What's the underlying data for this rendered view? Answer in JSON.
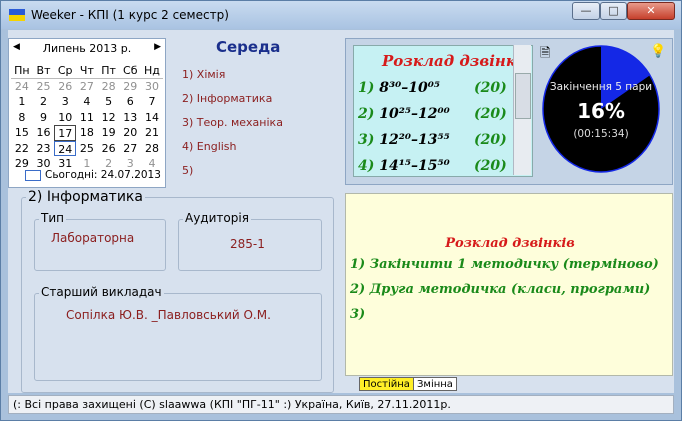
{
  "window": {
    "title": "Weeker - КПІ (1 курс 2 семестр)",
    "controls": {
      "minimize": "—",
      "maximize": "□",
      "close": "✕"
    }
  },
  "calendar": {
    "month_label": "Липень 2013 р.",
    "prev_icon": "◀",
    "next_icon": "▶",
    "weekdays": [
      "Пн",
      "Вт",
      "Ср",
      "Чт",
      "Пт",
      "Сб",
      "Нд"
    ],
    "weeks": [
      [
        "24",
        "25",
        "26",
        "27",
        "28",
        "29",
        "30"
      ],
      [
        "1",
        "2",
        "3",
        "4",
        "5",
        "6",
        "7"
      ],
      [
        "8",
        "9",
        "10",
        "11",
        "12",
        "13",
        "14"
      ],
      [
        "15",
        "16",
        "17",
        "18",
        "19",
        "20",
        "21"
      ],
      [
        "22",
        "23",
        "24",
        "25",
        "26",
        "27",
        "28"
      ],
      [
        "29",
        "30",
        "31",
        "1",
        "2",
        "3",
        "4"
      ]
    ],
    "today_text": "Сьогодні: 24.07.2013"
  },
  "day": {
    "title": "Середа",
    "lessons": [
      "1) Хімія",
      "2) Інформатика",
      "3) Теор. механіка",
      "4) English",
      "5)"
    ]
  },
  "bells": {
    "title": "Розклад дзвінків",
    "lines": [
      {
        "num": "1)",
        "time": "8³⁰–10⁰⁵",
        "dur": "(20)"
      },
      {
        "num": "2)",
        "time": "10²⁵–12⁰⁰",
        "dur": "(20)"
      },
      {
        "num": "3)",
        "time": "12²⁰–13⁵⁵",
        "dur": "(20)"
      },
      {
        "num": "4)",
        "time": "14¹⁵–15⁵⁰",
        "dur": "(20)"
      }
    ]
  },
  "progress": {
    "label": "Закінчення 5 пари",
    "percent_text": "16%",
    "percent": 16,
    "remaining": "(00:15:34)"
  },
  "lesson_detail": {
    "group_title": "2) Інформатика",
    "type_label": "Тип",
    "type_value": "Лабораторна",
    "room_label": "Аудиторія",
    "room_value": "285-1",
    "teacher_label": "Старший викладач",
    "teacher_value": "Сопілка Ю.В. _Павловський О.М."
  },
  "note": {
    "title": "Розклад дзвінків",
    "lines": [
      "1) Закінчити 1 методичку (терміново)",
      "2) Друга методичка (класи, програми)",
      "3)"
    ],
    "tabs": [
      "Постійна",
      "Змінна"
    ]
  },
  "status_bar": {
    "text": "(: Всі права захищені  (C)  slaawwa (КПІ \"ПГ-11\" :) Україна, Київ, 27.11.2011р."
  },
  "colors": {
    "pie_fill": "#1428e6",
    "pie_bg": "#000000",
    "note_bg": "#fefedb",
    "bell_bg": "#c6f1f3",
    "accent_red": "#d61a1a",
    "accent_green": "#1a8a1a"
  }
}
